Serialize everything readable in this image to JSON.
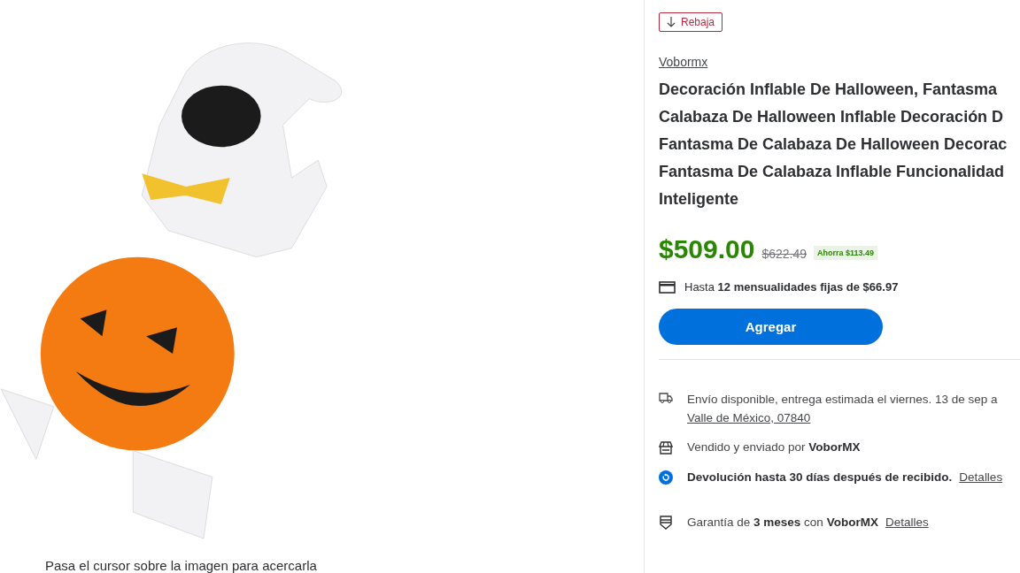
{
  "gallery": {
    "caption": "Pasa el cursor sobre la imagen para acercarla"
  },
  "badge": {
    "label": "Rebaja"
  },
  "seller_link": "Vobormx",
  "title_lines": [
    "Decoración Inflable De Halloween, Fantasma",
    "Calabaza De Halloween Inflable Decoración D",
    "Fantasma De Calabaza De Halloween Decorac",
    "Fantasma De Calabaza Inflable Funcionalidad",
    "Inteligente"
  ],
  "price": {
    "current": "$509.00",
    "was": "$622.49",
    "savings": "Ahorra $113.49"
  },
  "installments": "Hasta **12 mensualidades fijas de $66.97**",
  "add_button": "Agregar",
  "info_rows": [
    {
      "kind": "shipping",
      "text": "Envío disponible, entrega estimada el viernes. 13 de sep a",
      "link": "Valle de México, 07840"
    },
    {
      "kind": "seller",
      "text": "Vendido y enviado por  **VoborMX**"
    },
    {
      "kind": "returns",
      "text": "**Devolución hasta 30 días después de recibido.**",
      "link": "Detalles"
    },
    {
      "kind": "warranty",
      "text": "Garantía de **3 meses** con **VoborMX**",
      "link": "Detalles"
    }
  ]
}
